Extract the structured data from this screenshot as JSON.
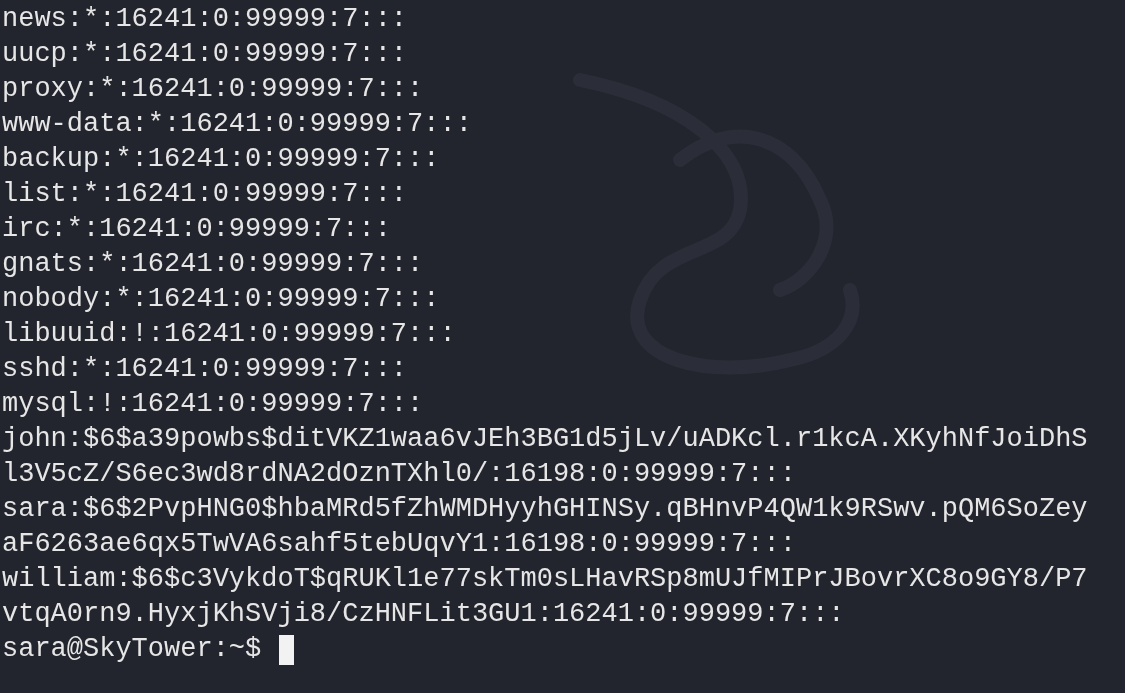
{
  "terminal": {
    "lines": [
      "news:*:16241:0:99999:7:::",
      "uucp:*:16241:0:99999:7:::",
      "proxy:*:16241:0:99999:7:::",
      "www-data:*:16241:0:99999:7:::",
      "backup:*:16241:0:99999:7:::",
      "list:*:16241:0:99999:7:::",
      "irc:*:16241:0:99999:7:::",
      "gnats:*:16241:0:99999:7:::",
      "nobody:*:16241:0:99999:7:::",
      "libuuid:!:16241:0:99999:7:::",
      "sshd:*:16241:0:99999:7:::",
      "mysql:!:16241:0:99999:7:::",
      "john:$6$a39powbs$ditVKZ1waa6vJEh3BG1d5jLv/uADKcl.r1kcA.XKyhNfJoiDhS",
      "l3V5cZ/S6ec3wd8rdNA2dOznTXhl0/:16198:0:99999:7:::",
      "sara:$6$2PvpHNG0$hbaMRd5fZhWMDHyyhGHINSy.qBHnvP4QW1k9RSwv.pQM6SoZey",
      "aF6263ae6qx5TwVA6sahf5tebUqvY1:16198:0:99999:7:::",
      "william:$6$c3VykdoT$qRUKl1e77skTm0sLHavRSp8mUJfMIPrJBovrXC8o9GY8/P7",
      "vtqA0rn9.HyxjKhSVji8/CzHNFLit3GU1:16241:0:99999:7:::"
    ],
    "prompt": "sara@SkyTower:~$"
  }
}
